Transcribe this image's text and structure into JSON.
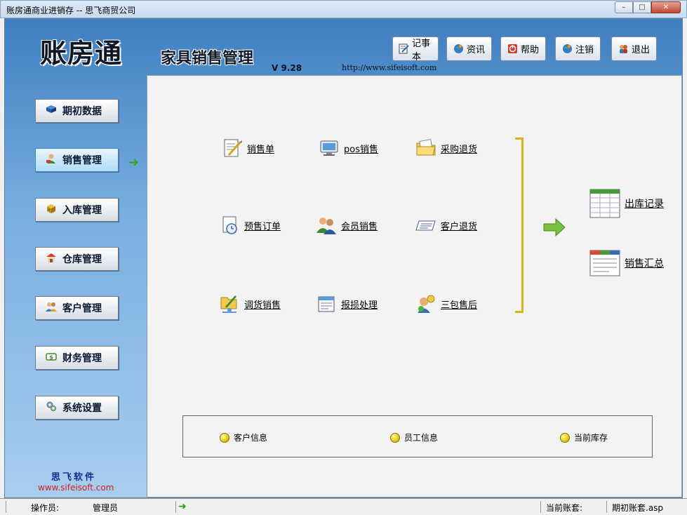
{
  "window": {
    "title": "账房通商业进销存 -- 思飞商贸公司",
    "min": "–",
    "max": "□",
    "close": "✕"
  },
  "header": {
    "logo_text": "账房通",
    "subtitle": "家具销售管理",
    "version": "V 9.28",
    "url": "http://www.sifeisoft.com"
  },
  "toolbar": [
    {
      "label": "记事本",
      "icon": "notepad-icon"
    },
    {
      "label": "资讯",
      "icon": "news-icon"
    },
    {
      "label": "帮助",
      "icon": "help-icon"
    },
    {
      "label": "注销",
      "icon": "logout-icon"
    },
    {
      "label": "退出",
      "icon": "exit-icon"
    }
  ],
  "sidebar": {
    "items": [
      {
        "label": "期初数据",
        "icon": "book-icon"
      },
      {
        "label": "销售管理",
        "icon": "sales-icon",
        "active": true
      },
      {
        "label": "入库管理",
        "icon": "box-icon"
      },
      {
        "label": "仓库管理",
        "icon": "warehouse-icon"
      },
      {
        "label": "客户管理",
        "icon": "customers-icon"
      },
      {
        "label": "财务管理",
        "icon": "money-icon"
      },
      {
        "label": "系统设置",
        "icon": "settings-icon"
      }
    ],
    "footer_cn": "思飞软件",
    "footer_url": "www.sifeisoft.com"
  },
  "functions": [
    {
      "label": "销售单",
      "icon": "sales-order-icon"
    },
    {
      "label": "pos销售",
      "icon": "pos-icon"
    },
    {
      "label": "采购退货",
      "icon": "folder-icon"
    },
    {
      "label": "预售订单",
      "icon": "presale-icon"
    },
    {
      "label": "会员销售",
      "icon": "members-icon"
    },
    {
      "label": "客户退货",
      "icon": "return-icon"
    },
    {
      "label": "调货销售",
      "icon": "transfer-icon"
    },
    {
      "label": "报损处理",
      "icon": "damage-icon"
    },
    {
      "label": "三包售后",
      "icon": "aftersale-icon"
    }
  ],
  "reports": [
    {
      "label": "出库记录",
      "icon": "table-icon"
    },
    {
      "label": "销售汇总",
      "icon": "summary-icon"
    }
  ],
  "info": [
    {
      "label": "客户信息"
    },
    {
      "label": "员工信息"
    },
    {
      "label": "当前库存"
    }
  ],
  "status": {
    "operator_label": "操作员:",
    "operator_value": "管理员",
    "account_label": "当前账套:",
    "account_value": "期初账套.asp"
  },
  "colors": {
    "accent": "#3e7ec0",
    "bracket": "#d6b418",
    "arrow": "#6ab42c"
  }
}
